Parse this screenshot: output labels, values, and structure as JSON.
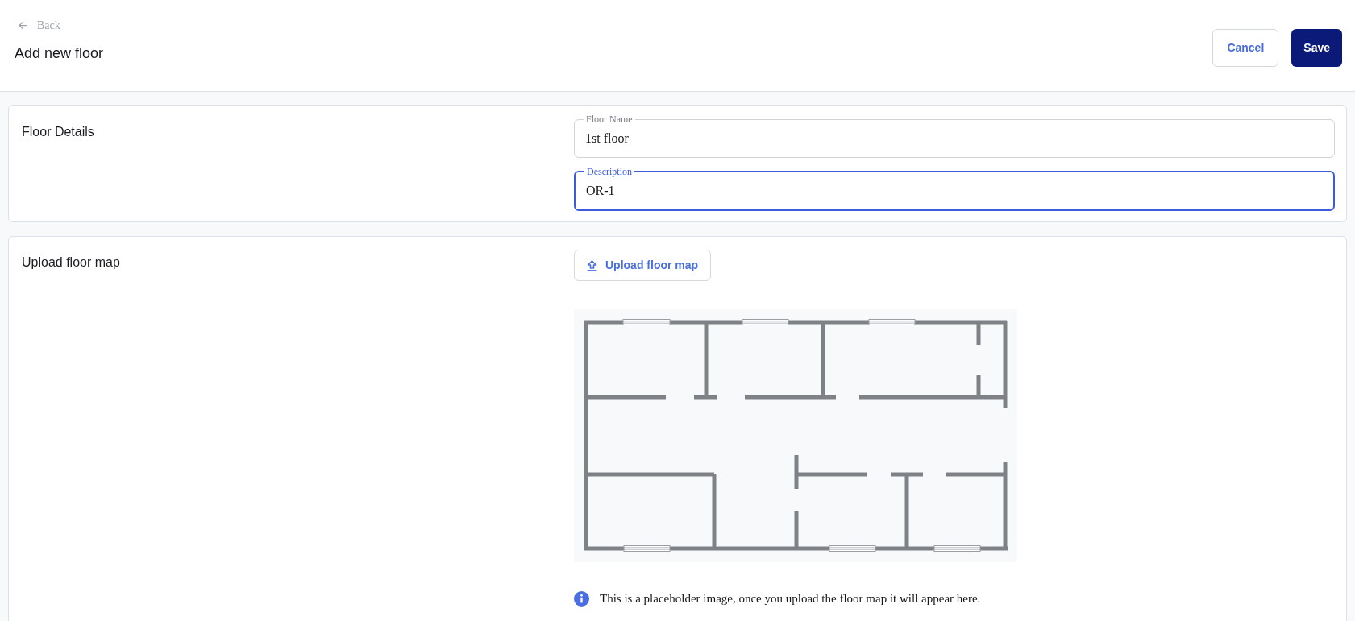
{
  "header": {
    "back_link": "Back",
    "title": "Add new floor",
    "buttons": [
      {
        "label": "Cancel",
        "kind": "secondary"
      },
      {
        "label": "Save",
        "kind": "primary"
      }
    ]
  },
  "sections": [
    {
      "kind": "fields",
      "title": "Floor Details",
      "fields": [
        {
          "label": "Floor Name",
          "value": "1st floor",
          "focused": false
        },
        {
          "label": "Description",
          "value": "OR-1",
          "focused": true
        }
      ]
    },
    {
      "kind": "upload",
      "title": "Upload floor map",
      "upload_button": "Upload floor map",
      "note": "This is a placeholder image, once you upload the floor map it will appear here."
    }
  ]
}
